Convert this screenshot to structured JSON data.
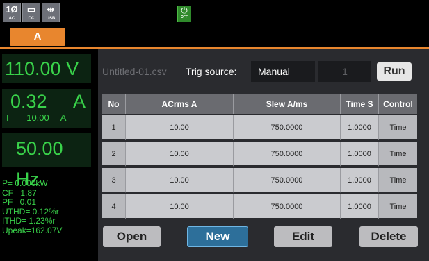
{
  "status": {
    "phase_label": "1Ø",
    "phase_caption": "AC",
    "mode_caption": "CC",
    "usb_caption": "USB",
    "power_caption": "OFF",
    "channel_tab": "A"
  },
  "meter": {
    "voltage": "110.00 V",
    "current": "0.32",
    "current_unit": "A",
    "i_label": "I=",
    "i_value": "10.00",
    "i_unit": "A",
    "frequency": "50.00 Hz",
    "readings": [
      "P= 0.000kW",
      "CF= 1.87",
      "PF= 0.01",
      "UTHD= 0.12%r",
      "ITHD= 1.23%r",
      "Upeak=162.07V"
    ]
  },
  "toolbar": {
    "file_name": "Untitled-01.csv",
    "trig_label": "Trig source:",
    "trig_value": "Manual",
    "step_number": "1",
    "run_label": "Run"
  },
  "table": {
    "headers": [
      "No",
      "ACrms A",
      "Slew A/ms",
      "Time S",
      "Control"
    ],
    "rows": [
      [
        "1",
        "10.00",
        "750.0000",
        "1.0000",
        "Time"
      ],
      [
        "2",
        "10.00",
        "750.0000",
        "1.0000",
        "Time"
      ],
      [
        "3",
        "10.00",
        "750.0000",
        "1.0000",
        "Time"
      ],
      [
        "4",
        "10.00",
        "750.0000",
        "1.0000",
        "Time"
      ]
    ]
  },
  "buttons": {
    "open": "Open",
    "new": "New",
    "edit": "Edit",
    "delete": "Delete"
  },
  "colors": {
    "accent": "#e8862e",
    "meter_text": "#39d24a",
    "selected_button": "#2d6f9a"
  }
}
